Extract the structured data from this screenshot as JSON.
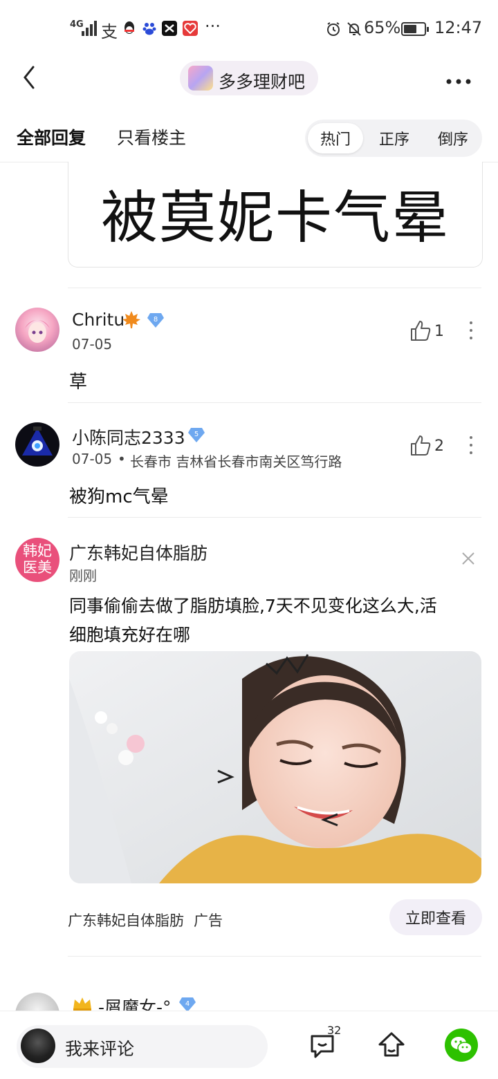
{
  "status_bar": {
    "network": "4G",
    "battery": "65%",
    "time": "12:47",
    "more_indicator": "···",
    "app_glyph": "支",
    "battery_level": 0.65
  },
  "nav": {
    "back_icon": "chevron-left-icon",
    "forum_name": "多多理财吧",
    "more_icon": "more-horizontal-icon"
  },
  "tabs": {
    "all_replies": "全部回复",
    "only_op": "只看楼主",
    "sort": [
      "热门",
      "正序",
      "倒序"
    ],
    "active_sort": "热门"
  },
  "quoted_image_text": "被莫妮卡气晕",
  "comments": [
    {
      "username": "Chritu",
      "badge_icon": "maple-leaf-icon",
      "level": "8",
      "date": "07-05",
      "location": "",
      "text": "草",
      "likes": "1"
    },
    {
      "username": "小陈同志2333",
      "level": "5",
      "date": "07-05",
      "location": "长春市 吉林省长春市南关区笃行路",
      "text": "被狗mc气晕",
      "likes": "2"
    }
  ],
  "ad": {
    "logo_text": [
      "韩妃",
      "医美"
    ],
    "name": "广东韩妃自体脂肪",
    "time": "刚刚",
    "text_line1": "同事偷偷去做了脂肪填脸,7天不见变化这么大,活",
    "text_line2": "细胞填充好在哪",
    "footer_name": "广东韩妃自体脂肪",
    "footer_tag": "广告",
    "cta": "立即查看"
  },
  "partial_comment": {
    "username": "-屑魔女-°",
    "level": "4"
  },
  "bottom_bar": {
    "comment_placeholder": "我来评论",
    "comment_count": "32"
  },
  "colors": {
    "level_badge": "#6ea8f0",
    "ad_logo": "#e9507b",
    "wechat": "#2dc100"
  }
}
